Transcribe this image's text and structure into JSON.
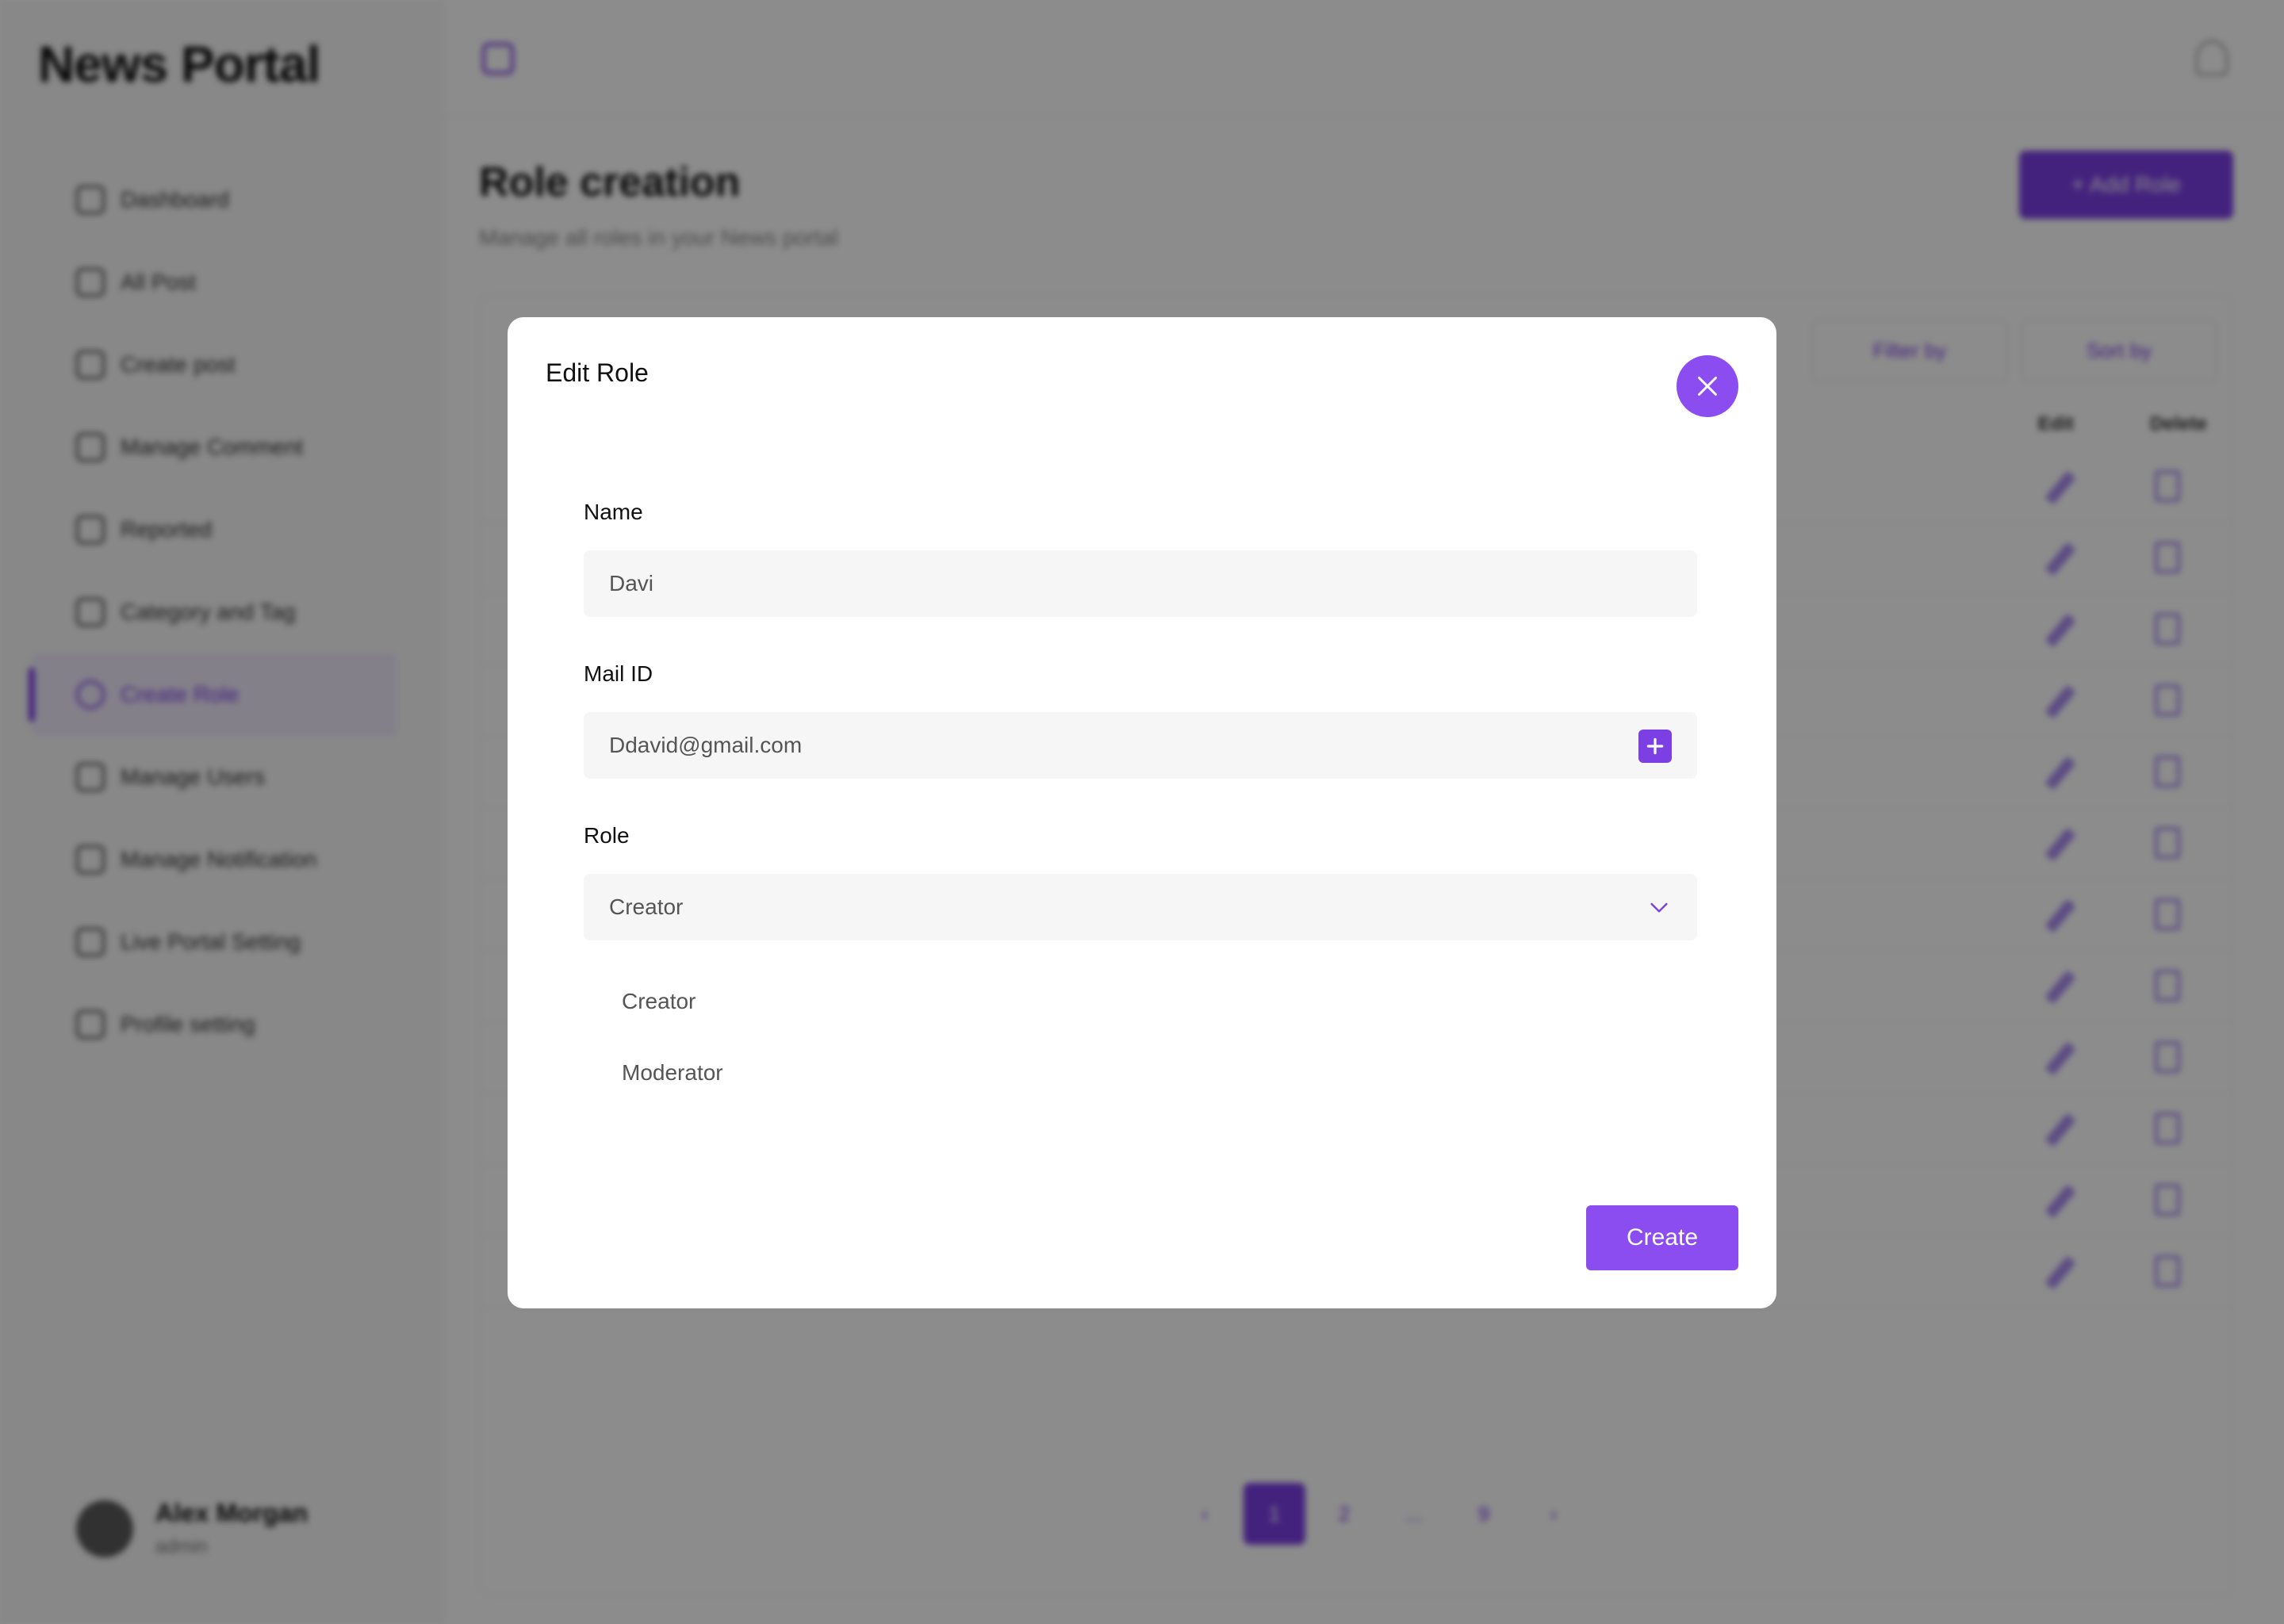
{
  "app": {
    "logo": "News Portal",
    "sidebar": {
      "items": [
        {
          "label": "Dashboard",
          "icon": "grid-icon"
        },
        {
          "label": "All Post",
          "icon": "document-icon"
        },
        {
          "label": "Create post",
          "icon": "plus-circle-icon"
        },
        {
          "label": "Manage Comment",
          "icon": "comment-icon"
        },
        {
          "label": "Reported",
          "icon": "flag-icon"
        },
        {
          "label": "Category and Tag",
          "icon": "tag-icon"
        },
        {
          "label": "Create Role",
          "icon": "user-icon",
          "active": true
        },
        {
          "label": "Manage Users",
          "icon": "users-icon"
        },
        {
          "label": "Manage Notification",
          "icon": "bell-icon"
        },
        {
          "label": "Live Portal Setting",
          "icon": "calendar-icon"
        },
        {
          "label": "Profile setting",
          "icon": "settings-icon"
        }
      ],
      "user": {
        "name": "Alex Morgan",
        "role": "admin"
      }
    },
    "main": {
      "title": "Role creation",
      "subtitle": "Manage all roles in your News portal",
      "add_button": "+ Add Role",
      "filter_label": "Filter by",
      "sort_label": "Sort by",
      "columns": {
        "edit": "Edit",
        "delete": "Delete"
      },
      "pagination": [
        "‹",
        "1",
        "2",
        "...",
        "9",
        "›"
      ]
    }
  },
  "modal": {
    "title": "Edit Role",
    "name_label": "Name",
    "name_value": "Davi",
    "mail_label": "Mail ID",
    "mail_value": "Ddavid@gmail.com",
    "role_label": "Role",
    "role_value": "Creator",
    "role_options": [
      "Creator",
      "Moderator"
    ],
    "submit_label": "Create"
  },
  "colors": {
    "accent": "#8b4cf0",
    "overlay": "rgba(0,0,0,0.45)"
  }
}
